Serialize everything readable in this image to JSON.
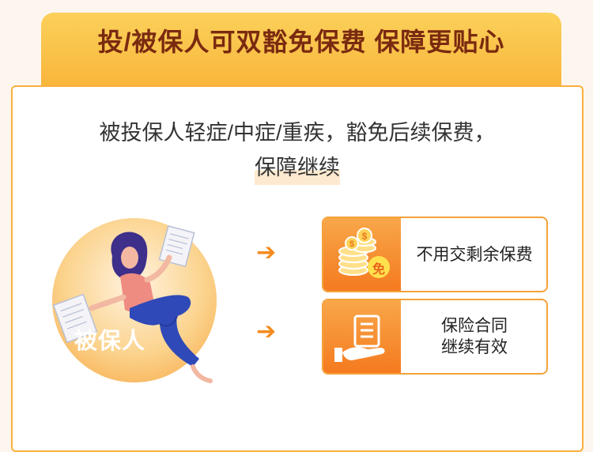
{
  "header": {
    "title": "投/被保人可双豁免保费 保障更贴心"
  },
  "description": {
    "line1": "被投保人轻症/中症/重疾，豁免后续保费，",
    "line2": "保障继续"
  },
  "person": {
    "label": "被保人"
  },
  "benefits": [
    {
      "icon": "coins-exempt-icon",
      "badge": "免",
      "label": "不用交剩余保费"
    },
    {
      "icon": "hand-document-icon",
      "label_line1": "保险合同",
      "label_line2": "继续有效"
    }
  ],
  "colors": {
    "header_gradient_top": "#fbd15a",
    "header_gradient_bottom": "#f9b43a",
    "title_text": "#7a2a10",
    "border_orange": "#f9b03a",
    "arrow_orange": "#f48b1f",
    "icon_bg": "#f57a1f"
  }
}
